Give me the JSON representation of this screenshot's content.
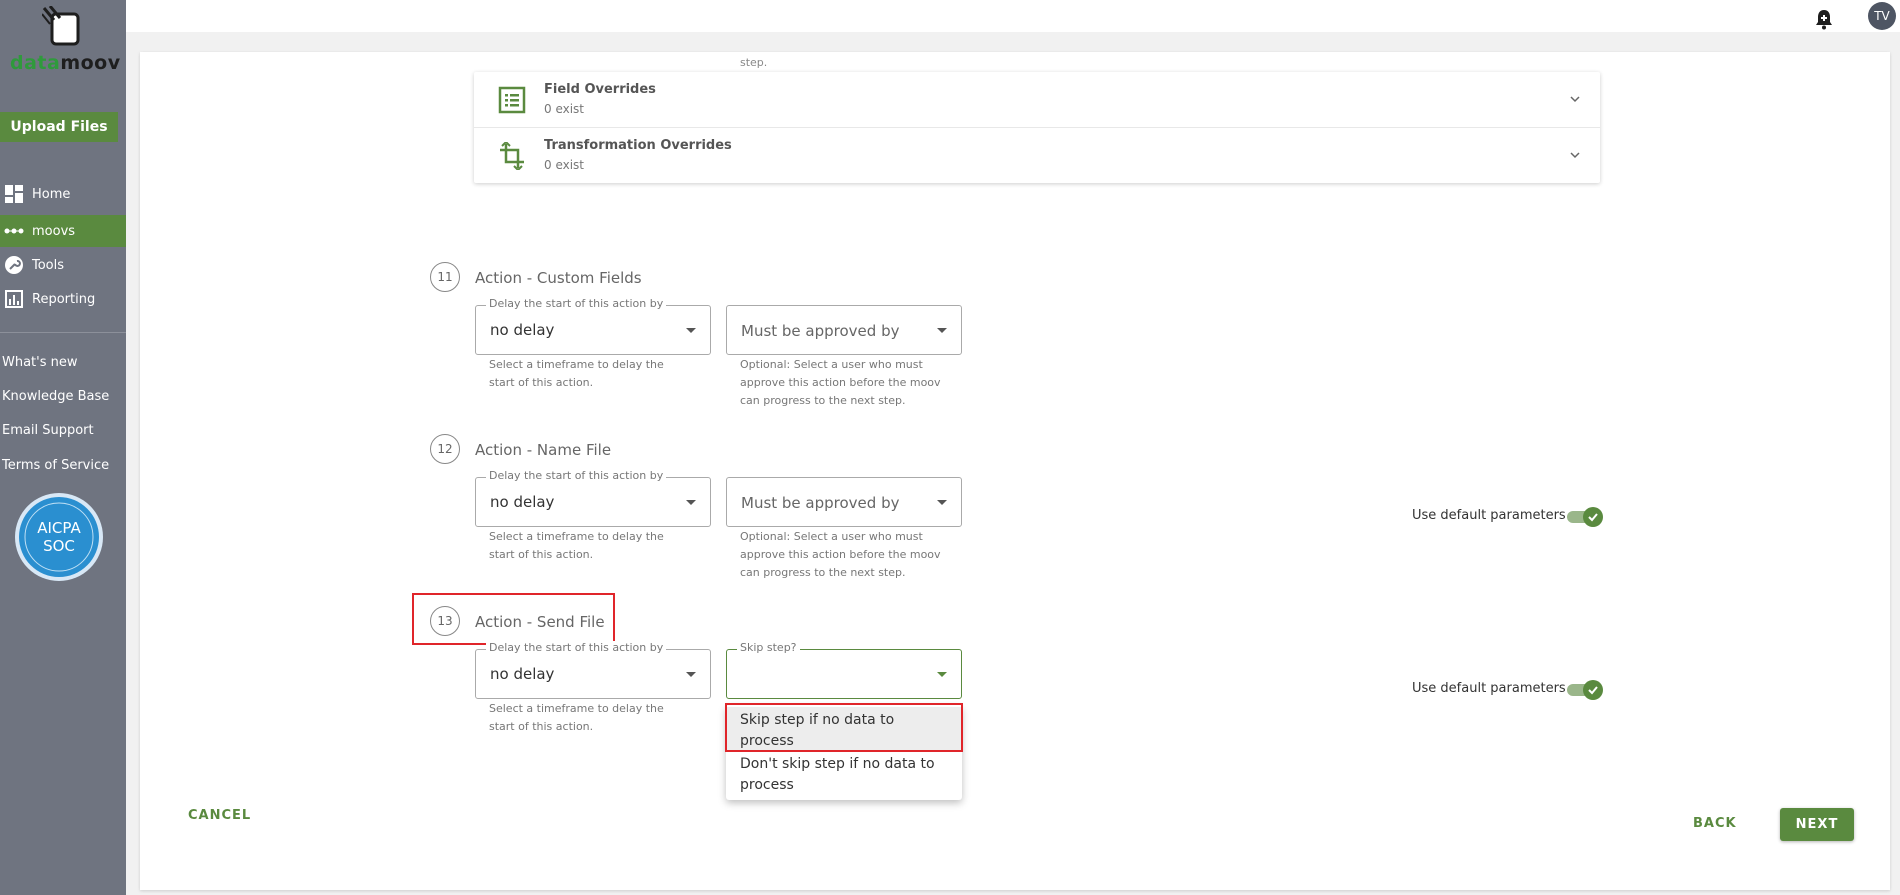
{
  "app": {
    "logo_text_a": "data",
    "logo_text_b": "moov",
    "upload_label": "Upload Files",
    "avatar_initials": "TV"
  },
  "sidebar": {
    "nav": [
      {
        "label": "Home",
        "icon": "dashboard-icon"
      },
      {
        "label": "moovs",
        "icon": "dots-icon",
        "active": true
      },
      {
        "label": "Tools",
        "icon": "wrench-icon"
      },
      {
        "label": "Reporting",
        "icon": "bar-chart-icon"
      }
    ],
    "links": [
      "What's new",
      "Knowledge Base",
      "Email Support",
      "Terms of Service"
    ],
    "badge": {
      "line1": "AICPA",
      "line2": "SOC"
    }
  },
  "overrides": {
    "step_tail": "step.",
    "field": {
      "title": "Field Overrides",
      "sub": "0 exist"
    },
    "transformation": {
      "title": "Transformation Overrides",
      "sub": "0 exist"
    }
  },
  "steps": [
    {
      "num": "11",
      "title": "Action - Custom Fields",
      "delay_legend": "Delay the start of this action by",
      "delay_value": "no delay",
      "delay_help": "Select a timeframe to delay the start of this action.",
      "approve_placeholder": "Must be approved by",
      "approve_help": "Optional: Select a user who must approve this action before the moov can progress to the next step."
    },
    {
      "num": "12",
      "title": "Action - Name File",
      "delay_legend": "Delay the start of this action by",
      "delay_value": "no delay",
      "delay_help": "Select a timeframe to delay the start of this action.",
      "approve_placeholder": "Must be approved by",
      "approve_help": "Optional: Select a user who must approve this action before the moov can progress to the next step.",
      "toggle_label": "Use default parameters"
    },
    {
      "num": "13",
      "title": "Action - Send File",
      "delay_legend": "Delay the start of this action by",
      "delay_value": "no delay",
      "delay_help": "Select a timeframe to delay the start of this action.",
      "skip_legend": "Skip step?",
      "toggle_label": "Use default parameters"
    }
  ],
  "dropdown": {
    "options": [
      "Skip step if no data to process",
      "Don't skip step if no data to process"
    ]
  },
  "footer": {
    "cancel": "CANCEL",
    "back": "BACK",
    "next": "NEXT"
  },
  "colors": {
    "accent": "#5a8a3f",
    "sidebar": "#6f7480",
    "highlight": "#e0252a"
  }
}
